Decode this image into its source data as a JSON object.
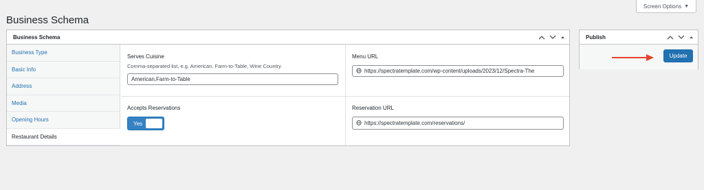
{
  "page": {
    "title": "Business Schema"
  },
  "screen_options": {
    "label": "Screen Options"
  },
  "main_box": {
    "title": "Business Schema",
    "tabs": [
      {
        "label": "Business Type"
      },
      {
        "label": "Basic Info"
      },
      {
        "label": "Address"
      },
      {
        "label": "Media"
      },
      {
        "label": "Opening Hours"
      },
      {
        "label": "Restaurant Details",
        "active": true
      }
    ],
    "fields": {
      "serves_cuisine": {
        "label": "Serves Cuisine",
        "description": "Comma-separated list, e.g. American, Farm-to-Table, Wine Country",
        "value": "American,Farm-to-Table"
      },
      "menu_url": {
        "label": "Menu URL",
        "value": "https://spectratemplate.com/wp-content/uploads/2023/12/Spectra-The"
      },
      "accepts_reservations": {
        "label": "Accepts Reservations",
        "toggle_text": "Yes",
        "on": true
      },
      "reservation_url": {
        "label": "Reservation URL",
        "value": "https://spectratemplate.com/reservations/"
      }
    }
  },
  "publish_box": {
    "title": "Publish",
    "update_label": "Update"
  },
  "colors": {
    "accent": "#2271b1",
    "link": "#2271b1",
    "arrow": "#e8412c",
    "background": "#f0f0f1"
  },
  "icons": [
    "chevron-up-icon",
    "chevron-down-icon",
    "triangle-up-icon",
    "globe-icon",
    "right-arrow-icon",
    "caret-down-icon"
  ]
}
